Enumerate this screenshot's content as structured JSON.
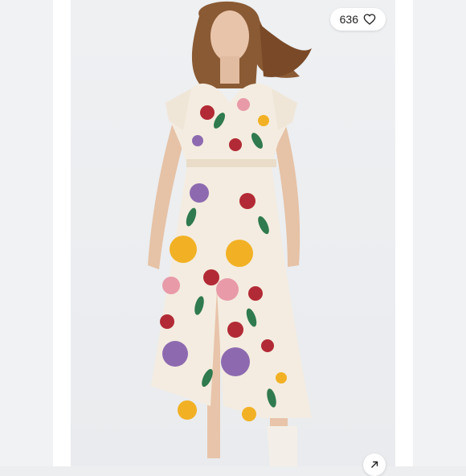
{
  "listing": {
    "likes_count": "636"
  },
  "icons": {
    "like": "heart-outline-icon",
    "share": "arrow-up-right-icon"
  },
  "colors": {
    "background": "#eceef0",
    "dress_base": "#f4ece0",
    "accent_yellow": "#f2b125",
    "accent_red": "#b22a35",
    "accent_purple": "#8d6ab0",
    "accent_pink": "#e89aa8",
    "leaf_green": "#2f7a4e"
  }
}
